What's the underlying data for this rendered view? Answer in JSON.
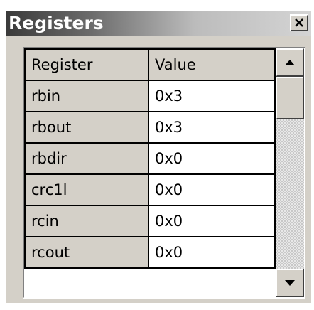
{
  "window": {
    "title": "Registers"
  },
  "table": {
    "columns": [
      "Register",
      "Value"
    ],
    "rows": [
      {
        "register": "rbin",
        "value": "0x3"
      },
      {
        "register": "rbout",
        "value": "0x3"
      },
      {
        "register": "rbdir",
        "value": "0x0"
      },
      {
        "register": "crc1l",
        "value": "0x0"
      },
      {
        "register": "rcin",
        "value": "0x0"
      },
      {
        "register": "rcout",
        "value": "0x0"
      }
    ]
  },
  "icons": {
    "close": "close-icon",
    "scroll_up": "arrow-up-icon",
    "scroll_down": "arrow-down-icon"
  },
  "colors": {
    "panel": "#d4d0c8",
    "title_gradient_start": "#3a3a3a",
    "title_gradient_end": "#d4d4d4",
    "cell_value_bg": "#ffffff"
  }
}
